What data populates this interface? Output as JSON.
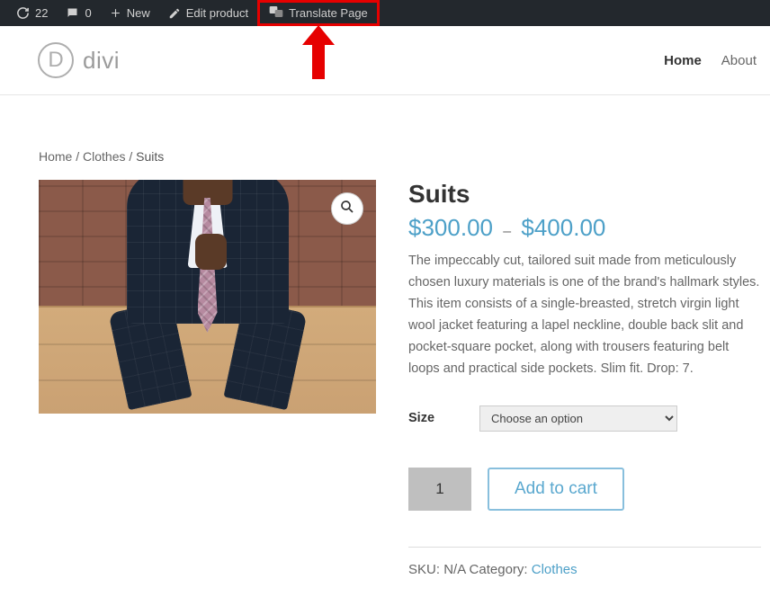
{
  "admin_bar": {
    "updates_count": "22",
    "comments_count": "0",
    "new_label": "New",
    "edit_label": "Edit product",
    "translate_label": "Translate Page"
  },
  "logo": {
    "letter": "D",
    "name": "divi"
  },
  "nav": {
    "home": "Home",
    "about": "About"
  },
  "breadcrumb": {
    "home": "Home",
    "cat": "Clothes",
    "current": "Suits"
  },
  "product": {
    "title": "Suits",
    "currency": "$",
    "price_low": "300.00",
    "price_high": "400.00",
    "dash": "–",
    "description": "The impeccably cut, tailored suit made from meticulously chosen luxury materials is one of the brand's hallmark styles. This item consists of a single-breasted, stretch virgin light wool jacket featuring a lapel neckline, double back slit and pocket-square pocket, along with trousers featuring belt loops and practical side pockets. Slim fit. Drop: 7.",
    "size_label": "Size",
    "size_placeholder": "Choose an option",
    "qty": "1",
    "add_label": "Add to cart",
    "sku_label": "SKU:",
    "sku_value": "N/A",
    "category_label": "Category:",
    "category_value": "Clothes"
  }
}
